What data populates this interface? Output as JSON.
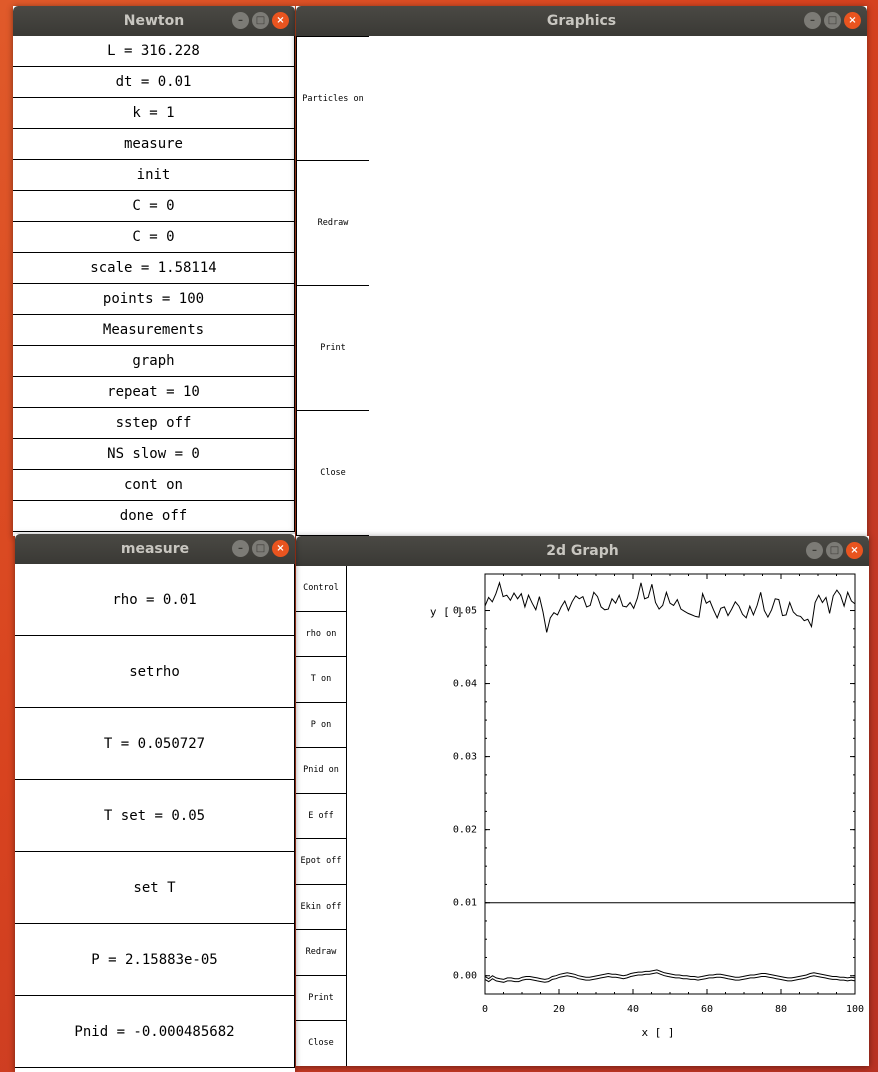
{
  "newton": {
    "title": "Newton",
    "buttons": [
      "L = 316.228",
      "dt = 0.01",
      "k = 1",
      "measure",
      "init",
      "C = 0",
      "C = 0",
      "scale = 1.58114",
      "points = 100",
      "Measurements",
      "graph",
      "repeat = 10",
      "sstep off",
      "NS slow = 0",
      "cont on",
      "done off"
    ]
  },
  "graphics": {
    "title": "Graphics",
    "buttons": [
      "Particles on",
      "Redraw",
      "Print",
      "Close"
    ]
  },
  "measure": {
    "title": "measure",
    "buttons": [
      "rho = 0.01",
      "setrho",
      "T = 0.050727",
      "T set = 0.05",
      "set T",
      "P = 2.15883e-05",
      "Pnid = -0.000485682"
    ]
  },
  "graph2d": {
    "title": "2d Graph",
    "buttons": [
      "Control",
      "rho on",
      "T on",
      "P on",
      "Pnid on",
      "E off",
      "Epot off",
      "Ekin off",
      "Redraw",
      "Print",
      "Close"
    ]
  },
  "window_controls": {
    "minimize": "–",
    "maximize": "□",
    "close": "×"
  },
  "chart_data": {
    "type": "line",
    "xlabel": "x [ ]",
    "ylabel": "y [ ]",
    "xlim": [
      0,
      100
    ],
    "ylim": [
      -0.0025,
      0.055
    ],
    "xticks": [
      "0",
      "20",
      "40",
      "60",
      "80",
      "100"
    ],
    "yticks": [
      "0.00",
      "0.01",
      "0.02",
      "0.03",
      "0.04",
      "0.05"
    ],
    "series": [
      {
        "values": [
          0.0506,
          0.0518,
          0.0512,
          0.0523,
          0.0538,
          0.0519,
          0.0521,
          0.0514,
          0.0524,
          0.0516,
          0.0523,
          0.0505,
          0.0521,
          0.051,
          0.0501,
          0.0519,
          0.0498,
          0.047,
          0.049,
          0.0497,
          0.0494,
          0.0505,
          0.0513,
          0.05,
          0.0512,
          0.052,
          0.0516,
          0.0519,
          0.0505,
          0.0507,
          0.0525,
          0.0519,
          0.0505,
          0.0501,
          0.0502,
          0.0516,
          0.051,
          0.0521,
          0.0506,
          0.0505,
          0.0511,
          0.0503,
          0.0517,
          0.0538,
          0.0516,
          0.0518,
          0.0536,
          0.0511,
          0.0502,
          0.0507,
          0.0525,
          0.051,
          0.0507,
          0.0515,
          0.0502,
          0.0499,
          0.0496,
          0.0494,
          0.0492,
          0.0491,
          0.0523,
          0.051,
          0.0513,
          0.0501,
          0.049,
          0.0503,
          0.0505,
          0.0493,
          0.0502,
          0.0512,
          0.0506,
          0.0495,
          0.049,
          0.0506,
          0.0494,
          0.0507,
          0.0525,
          0.05,
          0.0491,
          0.0501,
          0.0516,
          0.0515,
          0.0493,
          0.0494,
          0.0511,
          0.0498,
          0.0493,
          0.0492,
          0.0486,
          0.0488,
          0.0478,
          0.0511,
          0.0521,
          0.0511,
          0.0518,
          0.0496,
          0.052,
          0.0528,
          0.0521,
          0.0506,
          0.0525,
          0.0513,
          0.0509
        ]
      },
      {
        "values": [
          0.01,
          0.01
        ]
      },
      {
        "values": [
          -0.0001,
          -0.0004,
          0.0,
          -0.0003,
          -0.0004,
          -0.0005,
          -0.0003,
          -0.0003,
          -0.0004,
          -0.0004,
          -0.0002,
          -0.0001,
          -0.0001,
          -0.0002,
          -0.0003,
          -0.0004,
          -0.0005,
          -0.0004,
          -0.0001,
          0.0,
          0.0002,
          0.0003,
          0.0004,
          0.0003,
          0.0002,
          0.0,
          -0.0001,
          -0.0002,
          -0.0002,
          -0.0001,
          0.0,
          0.0001,
          0.0002,
          0.0003,
          0.0002,
          0.0002,
          0.0001,
          0.0,
          0.0001,
          0.0003,
          0.0004,
          0.0005,
          0.0005,
          0.0006,
          0.0006,
          0.0007,
          0.0008,
          0.0006,
          0.0004,
          0.0003,
          0.0002,
          0.0001,
          0.0001,
          0.0,
          0.0,
          -0.0001,
          -0.0001,
          -0.0002,
          -0.0001,
          0.0,
          0.0001,
          0.0001,
          0.0002,
          0.0002,
          0.0001,
          0.0,
          -0.0001,
          -0.0002,
          -0.0002,
          -0.0001,
          0.0,
          0.0001,
          0.0001,
          0.0002,
          0.0003,
          0.0003,
          0.0002,
          0.0001,
          0.0,
          -0.0001,
          -0.0002,
          -0.0003,
          -0.0003,
          -0.0002,
          -0.0001,
          0.0,
          0.0001,
          0.0003,
          0.0004,
          0.0003,
          0.0002,
          0.0001,
          0.0,
          -0.0001,
          -0.0001,
          -0.0002,
          -0.0002,
          -0.0003,
          -0.0002,
          -0.0003
        ]
      },
      {
        "values": [
          -0.0005,
          -0.0008,
          -0.0004,
          -0.0007,
          -0.0008,
          -0.0009,
          -0.0007,
          -0.0007,
          -0.0008,
          -0.0008,
          -0.0006,
          -0.0005,
          -0.0005,
          -0.0006,
          -0.0007,
          -0.0008,
          -0.0009,
          -0.0008,
          -0.0005,
          -0.0004,
          -0.0002,
          -0.0001,
          0.0,
          -0.0001,
          -0.0002,
          -0.0004,
          -0.0005,
          -0.0006,
          -0.0006,
          -0.0005,
          -0.0004,
          -0.0003,
          -0.0002,
          -0.0001,
          -0.0002,
          -0.0002,
          -0.0003,
          -0.0004,
          -0.0003,
          -0.0001,
          0.0,
          0.0001,
          0.0001,
          0.0002,
          0.0002,
          0.0003,
          0.0004,
          0.0002,
          0.0,
          -0.0001,
          -0.0002,
          -0.0003,
          -0.0003,
          -0.0004,
          -0.0004,
          -0.0005,
          -0.0005,
          -0.0006,
          -0.0005,
          -0.0004,
          -0.0003,
          -0.0003,
          -0.0002,
          -0.0002,
          -0.0003,
          -0.0004,
          -0.0005,
          -0.0006,
          -0.0006,
          -0.0005,
          -0.0004,
          -0.0003,
          -0.0003,
          -0.0002,
          -0.0001,
          -0.0001,
          -0.0002,
          -0.0003,
          -0.0004,
          -0.0005,
          -0.0006,
          -0.0007,
          -0.0007,
          -0.0006,
          -0.0005,
          -0.0004,
          -0.0003,
          -0.0001,
          0.0,
          -0.0001,
          -0.0002,
          -0.0003,
          -0.0004,
          -0.0005,
          -0.0005,
          -0.0006,
          -0.0006,
          -0.0007,
          -0.0006,
          -0.0007
        ]
      }
    ]
  }
}
